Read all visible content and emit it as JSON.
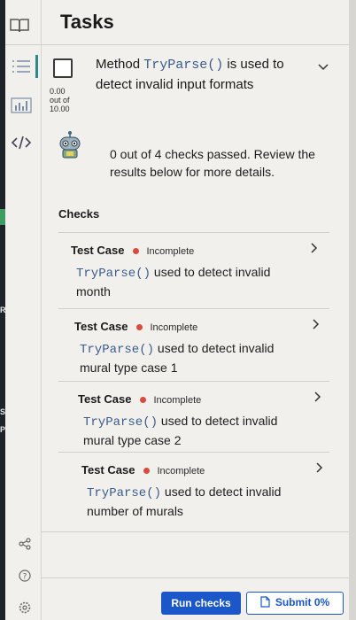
{
  "header": {
    "title": "Tasks"
  },
  "task": {
    "text_prefix": "Method ",
    "code": "TryParse()",
    "text_suffix": " is used to detect invalid input formats",
    "score_value": "0.00",
    "score_mid": "out of",
    "score_total": "10.00"
  },
  "summary": {
    "text": "0 out of 4 checks passed. Review the results below for more details."
  },
  "checks": {
    "title": "Checks",
    "items": [
      {
        "label": "Test Case",
        "status": "Incomplete",
        "code": "TryParse()",
        "desc": " used to detect invalid month"
      },
      {
        "label": "Test Case",
        "status": "Incomplete",
        "code": "TryParse()",
        "desc": " used to detect invalid mural type case 1"
      },
      {
        "label": "Test Case",
        "status": "Incomplete",
        "code": "TryParse()",
        "desc": " used to detect invalid mural type case 2"
      },
      {
        "label": "Test Case",
        "status": "Incomplete",
        "code": "TryParse()",
        "desc": " used to detect invalid number of murals"
      }
    ]
  },
  "footer": {
    "run_label": "Run checks",
    "submit_label": "Submit 0%"
  },
  "left_edge": {
    "frag1": "RE",
    "frag2": "Sc",
    "frag3": "Pr"
  },
  "colors": {
    "accent": "#1b57c9",
    "incomplete_dot": "#d84a3c",
    "teal": "#2e8a8a"
  },
  "icons": [
    "book-icon",
    "list-icon",
    "chart-icon",
    "code-icon",
    "robot-icon",
    "chevron-down-icon",
    "chevron-right-icon",
    "share-icon",
    "help-icon",
    "settings-icon",
    "document-icon"
  ]
}
